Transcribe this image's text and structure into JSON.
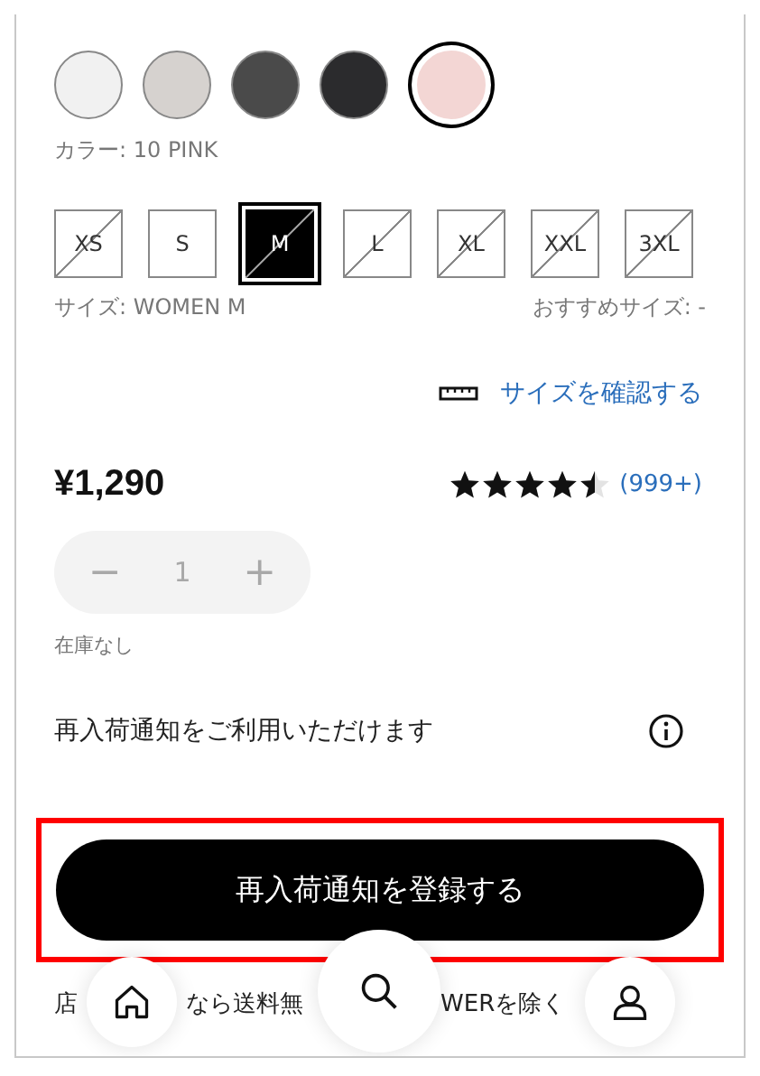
{
  "colors": [
    {
      "color": "#f1f1f1",
      "selected": false
    },
    {
      "color": "#d6d2cf",
      "selected": false
    },
    {
      "color": "#4a4a4a",
      "selected": false
    },
    {
      "color": "#2b2b2d",
      "selected": false
    },
    {
      "color": "#f3d6d4",
      "selected": true
    }
  ],
  "color_label": "カラー: 10 PINK",
  "sizes": [
    {
      "label": "XS",
      "available": false,
      "selected": false
    },
    {
      "label": "S",
      "available": true,
      "selected": false
    },
    {
      "label": "M",
      "available": false,
      "selected": true
    },
    {
      "label": "L",
      "available": false,
      "selected": false
    },
    {
      "label": "XL",
      "available": false,
      "selected": false
    },
    {
      "label": "XXL",
      "available": false,
      "selected": false
    },
    {
      "label": "3XL",
      "available": false,
      "selected": false
    }
  ],
  "size_label": "サイズ: WOMEN M",
  "recommended_size": "おすすめサイズ: -",
  "size_guide_link": "サイズを確認する",
  "price": "¥1,290",
  "rating": {
    "stars": 4.5,
    "count": "(999+)"
  },
  "quantity": {
    "minus": "−",
    "value": "1",
    "plus": "+",
    "disabled": true
  },
  "stock_status": "在庫なし",
  "restock_notice": "再入荷通知をご利用いただけます",
  "restock_button": {
    "label": "再入荷通知を登録する",
    "highlighted": true
  },
  "shipping_note_fragments": [
    "店",
    "なら送料無",
    "WERを除く"
  ],
  "bottom_nav": [
    {
      "kind": "home"
    },
    {
      "kind": "search"
    },
    {
      "kind": "user"
    }
  ]
}
